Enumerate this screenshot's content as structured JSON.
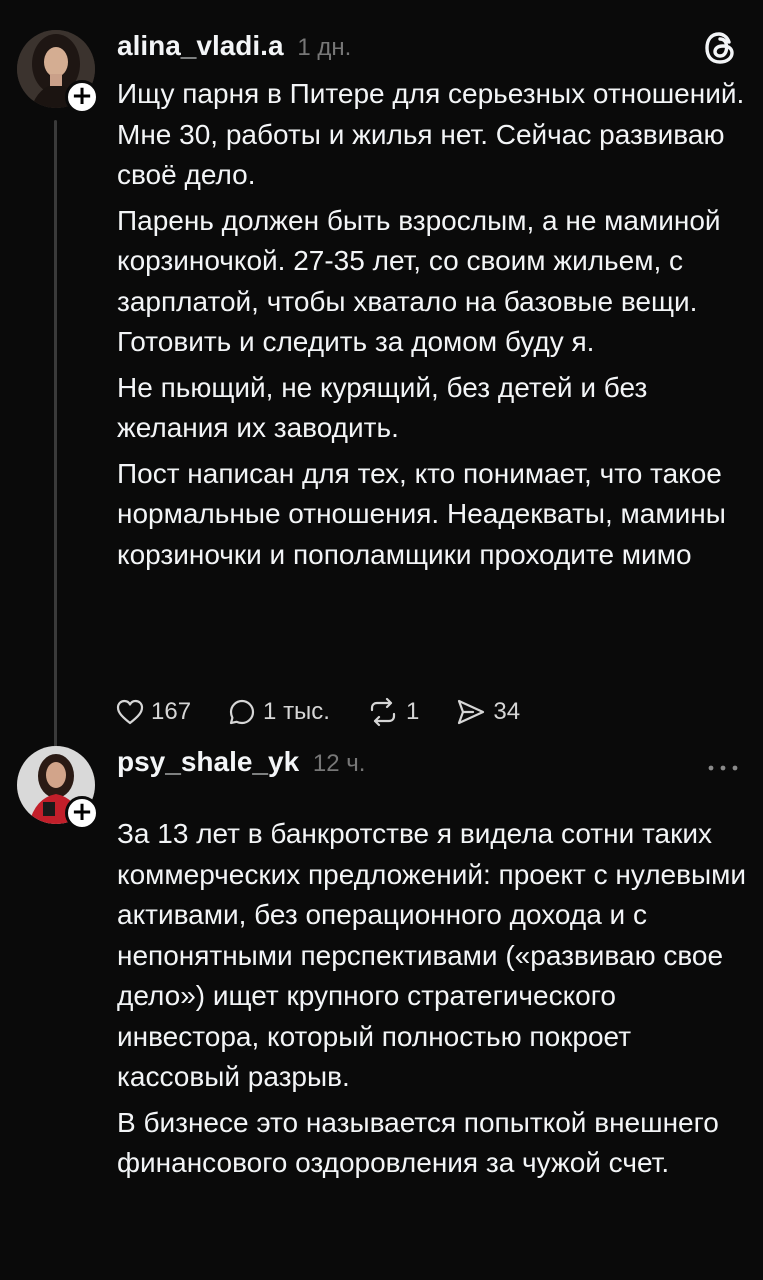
{
  "post1": {
    "username": "alina_vladi.a",
    "time": "1 дн.",
    "paragraphs": [
      "Ищу парня в Питере для серьезных отношений. Мне 30, работы и жилья нет. Сейчас развиваю своё дело.",
      "Парень должен быть взрослым, а не маминой корзиночкой. 27-35 лет, со своим жильем, с зарплатой, чтобы хватало на базовые вещи. Готовить и следить за домом буду я.",
      "Не пьющий, не курящий, без детей и без желания их заводить.",
      "Пост написан для тех, кто понимает, что такое нормальные отношения. Неадекваты, мамины корзиночки и пополамщики проходите мимо"
    ],
    "likes": "167",
    "replies": "1 тыс.",
    "reposts": "1",
    "shares": "34",
    "logo_icon": "threads-logo-icon"
  },
  "post2": {
    "username": "psy_shale_yk",
    "time": "12 ч.",
    "paragraphs": [
      "За 13 лет в банкротстве я видела сотни таких коммерческих предложений: проект с нулевыми активами, без операционного дохода и с непонятными перспективами («развиваю свое дело») ищет крупного стратегического инвестора, который полностью покроет кассовый разрыв.",
      "В бизнесе это называется попыткой внешнего финансового оздоровления за чужой счет."
    ],
    "more_icon": "more-horizontal-icon"
  },
  "colors": {
    "background": "#0a0a0a",
    "text": "#f3f5f7",
    "muted": "#777777",
    "thread_line": "#3a3a3a"
  }
}
